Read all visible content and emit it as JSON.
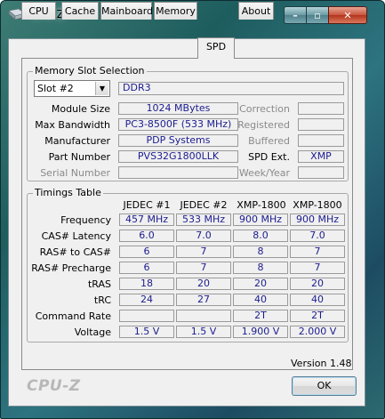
{
  "window": {
    "title": "CPU-Z"
  },
  "titlebar": {
    "min_glyph": "–",
    "max_glyph": "▫",
    "close_glyph": "✕"
  },
  "tabs": [
    {
      "label": "CPU"
    },
    {
      "label": "Cache"
    },
    {
      "label": "Mainboard"
    },
    {
      "label": "Memory"
    },
    {
      "label": "SPD"
    },
    {
      "label": "About"
    }
  ],
  "memory_slot": {
    "group_label": "Memory Slot Selection",
    "slot_selected": "Slot #2",
    "type": "DDR3",
    "labels": {
      "module_size": "Module Size",
      "max_bandwidth": "Max Bandwidth",
      "manufacturer": "Manufacturer",
      "part_number": "Part Number",
      "serial_number": "Serial Number",
      "correction": "Correction",
      "registered": "Registered",
      "buffered": "Buffered",
      "spd_ext": "SPD Ext.",
      "week_year": "Week/Year"
    },
    "values": {
      "module_size": "1024 MBytes",
      "max_bandwidth": "PC3-8500F (533 MHz)",
      "manufacturer": "PDP Systems",
      "part_number": "PVS32G1800LLK",
      "serial_number": "",
      "correction": "",
      "registered": "",
      "buffered": "",
      "spd_ext": "XMP",
      "week_year": ""
    }
  },
  "timings": {
    "group_label": "Timings Table",
    "columns": [
      "JEDEC #1",
      "JEDEC #2",
      "XMP-1800",
      "XMP-1800"
    ],
    "rows": [
      {
        "label": "Frequency",
        "values": [
          "457 MHz",
          "533 MHz",
          "900 MHz",
          "900 MHz"
        ]
      },
      {
        "label": "CAS# Latency",
        "values": [
          "6.0",
          "7.0",
          "8.0",
          "7.0"
        ]
      },
      {
        "label": "RAS# to CAS#",
        "values": [
          "6",
          "7",
          "8",
          "7"
        ]
      },
      {
        "label": "RAS# Precharge",
        "values": [
          "6",
          "7",
          "8",
          "7"
        ]
      },
      {
        "label": "tRAS",
        "values": [
          "18",
          "20",
          "20",
          "20"
        ]
      },
      {
        "label": "tRC",
        "values": [
          "24",
          "27",
          "40",
          "40"
        ]
      },
      {
        "label": "Command Rate",
        "values": [
          "",
          "",
          "2T",
          "2T"
        ]
      },
      {
        "label": "Voltage",
        "values": [
          "1.5 V",
          "1.5 V",
          "1.900 V",
          "2.000 V"
        ]
      }
    ]
  },
  "footer": {
    "logo": "CPU-Z",
    "version": "Version 1.48",
    "ok_label": "OK"
  }
}
